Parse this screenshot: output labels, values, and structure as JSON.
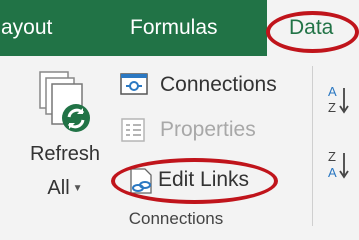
{
  "tabs": {
    "page_layout": "ayout",
    "formulas": "Formulas",
    "data": "Data"
  },
  "connections_group": {
    "refresh_label_1": "Refresh",
    "refresh_label_2": "All",
    "connections": "Connections",
    "properties": "Properties",
    "edit_links": "Edit Links",
    "group_label": "Connections"
  },
  "sort": {
    "sort_az_icon": "sort-a-to-z-icon",
    "sort_za_icon": "sort-z-to-a-icon"
  },
  "colors": {
    "excel_green": "#217346",
    "highlight_red": "#c0141b",
    "ribbon_bg": "#f3f3f3",
    "disabled_text": "#a8a8a8"
  }
}
